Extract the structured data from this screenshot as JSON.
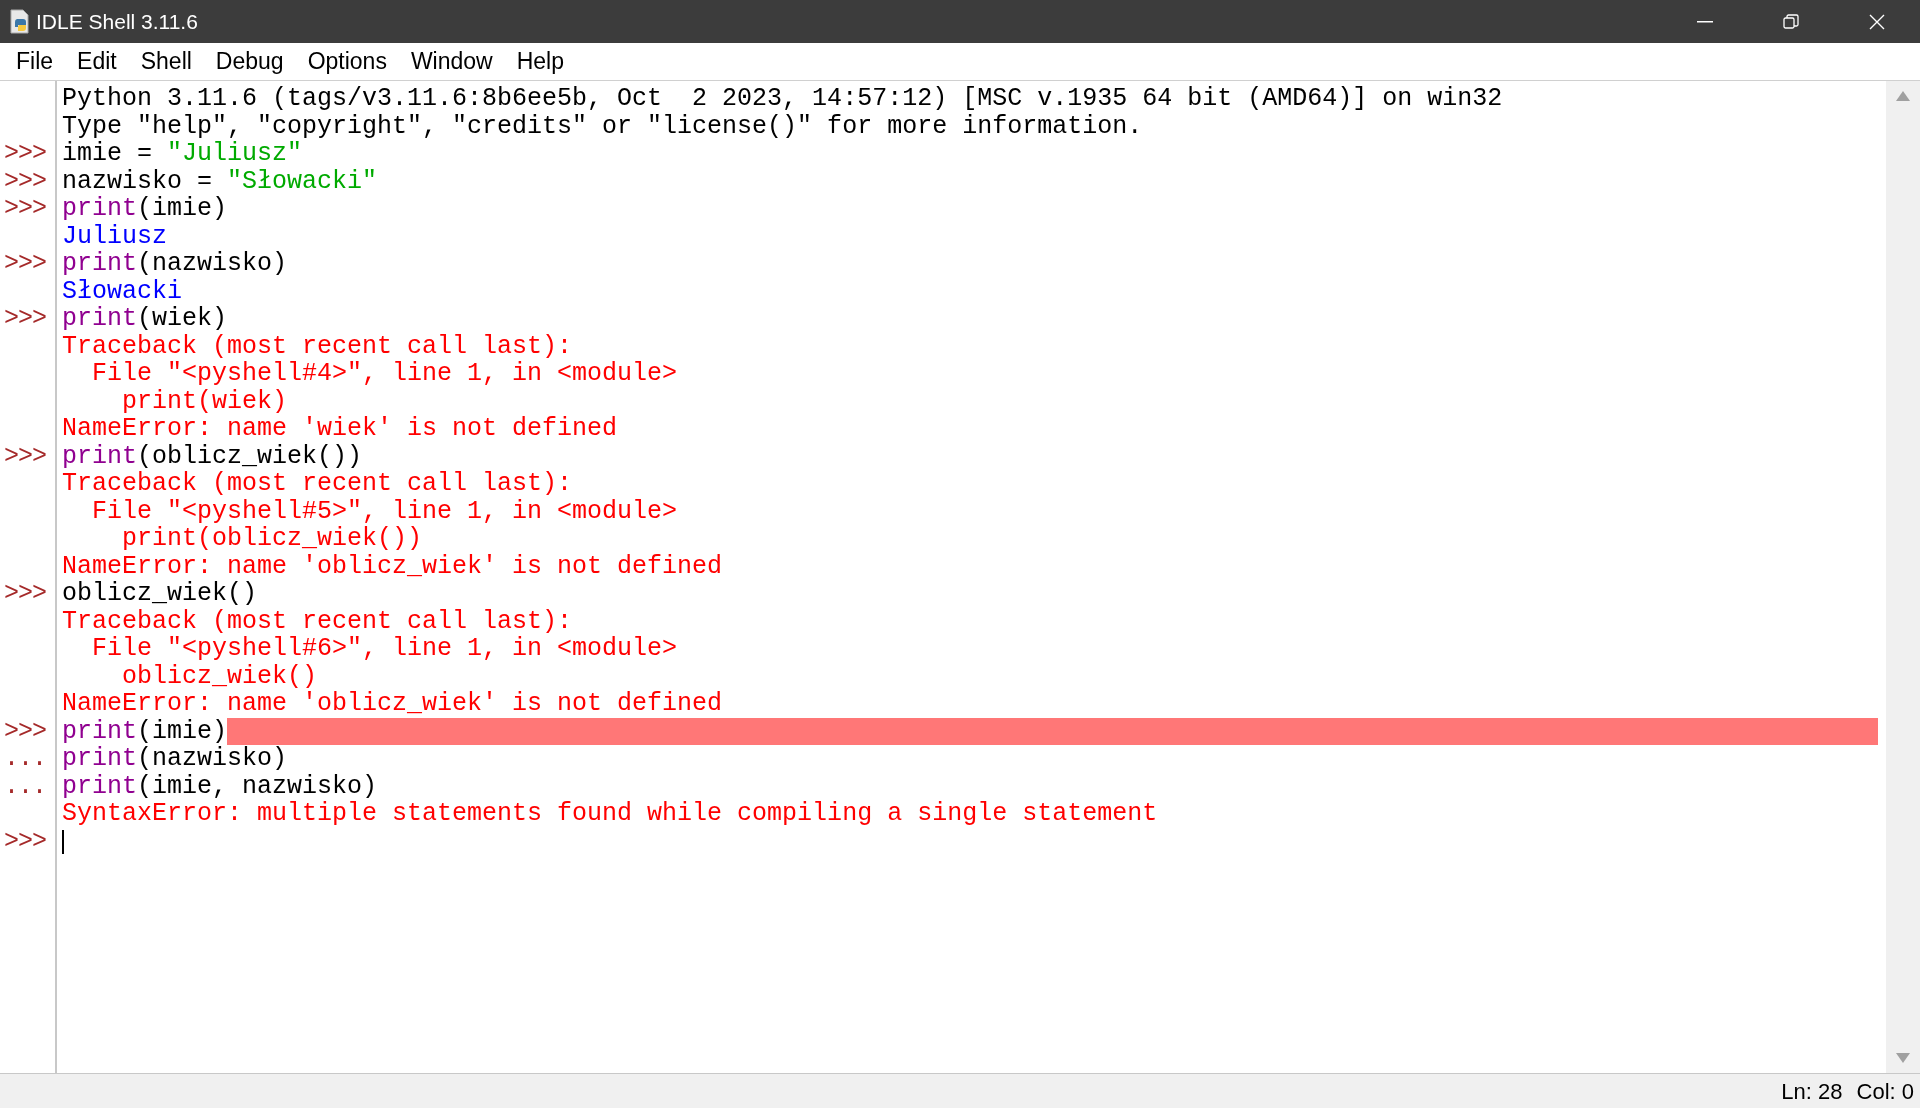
{
  "window": {
    "title": "IDLE Shell 3.11.6"
  },
  "menu": [
    "File",
    "Edit",
    "Shell",
    "Debug",
    "Options",
    "Window",
    "Help"
  ],
  "shell": {
    "lines": [
      {
        "marked": false,
        "cursor": false,
        "segments": [
          {
            "kind": "code",
            "text": "Python 3.11.6 (tags/v3.11.6:8b6ee5b, Oct  2 2023, 14:57:12) [MSC v.1935 64 bit (AMD64)] on win32"
          }
        ]
      },
      {
        "marked": false,
        "cursor": false,
        "segments": [
          {
            "kind": "code",
            "text": "Type \"help\", \"copyright\", \"credits\" or \"license()\" for more information."
          }
        ]
      },
      {
        "prompt": ">>>",
        "marked": false,
        "cursor": false,
        "segments": [
          {
            "kind": "code",
            "text": "imie = "
          },
          {
            "kind": "string",
            "text": "\"Juliusz\""
          }
        ]
      },
      {
        "prompt": ">>>",
        "marked": false,
        "cursor": false,
        "segments": [
          {
            "kind": "code",
            "text": "nazwisko = "
          },
          {
            "kind": "string",
            "text": "\"Słowacki\""
          }
        ]
      },
      {
        "prompt": ">>>",
        "marked": false,
        "cursor": false,
        "segments": [
          {
            "kind": "builtin",
            "text": "print"
          },
          {
            "kind": "code",
            "text": "(imie)"
          }
        ]
      },
      {
        "marked": false,
        "cursor": false,
        "segments": [
          {
            "kind": "output",
            "text": "Juliusz"
          }
        ]
      },
      {
        "prompt": ">>>",
        "marked": false,
        "cursor": false,
        "segments": [
          {
            "kind": "builtin",
            "text": "print"
          },
          {
            "kind": "code",
            "text": "(nazwisko)"
          }
        ]
      },
      {
        "marked": false,
        "cursor": false,
        "segments": [
          {
            "kind": "output",
            "text": "Słowacki"
          }
        ]
      },
      {
        "prompt": ">>>",
        "marked": false,
        "cursor": false,
        "segments": [
          {
            "kind": "builtin",
            "text": "print"
          },
          {
            "kind": "code",
            "text": "(wiek)"
          }
        ]
      },
      {
        "marked": false,
        "cursor": false,
        "segments": [
          {
            "kind": "error",
            "text": "Traceback (most recent call last):"
          }
        ]
      },
      {
        "marked": false,
        "cursor": false,
        "segments": [
          {
            "kind": "error",
            "text": "  File \"<pyshell#4>\", line 1, in <module>"
          }
        ]
      },
      {
        "marked": false,
        "cursor": false,
        "segments": [
          {
            "kind": "error",
            "text": "    print(wiek)"
          }
        ]
      },
      {
        "marked": false,
        "cursor": false,
        "segments": [
          {
            "kind": "error",
            "text": "NameError: name 'wiek' is not defined"
          }
        ]
      },
      {
        "prompt": ">>>",
        "marked": false,
        "cursor": false,
        "segments": [
          {
            "kind": "builtin",
            "text": "print"
          },
          {
            "kind": "code",
            "text": "(oblicz_wiek())"
          }
        ]
      },
      {
        "marked": false,
        "cursor": false,
        "segments": [
          {
            "kind": "error",
            "text": "Traceback (most recent call last):"
          }
        ]
      },
      {
        "marked": false,
        "cursor": false,
        "segments": [
          {
            "kind": "error",
            "text": "  File \"<pyshell#5>\", line 1, in <module>"
          }
        ]
      },
      {
        "marked": false,
        "cursor": false,
        "segments": [
          {
            "kind": "error",
            "text": "    print(oblicz_wiek())"
          }
        ]
      },
      {
        "marked": false,
        "cursor": false,
        "segments": [
          {
            "kind": "error",
            "text": "NameError: name 'oblicz_wiek' is not defined"
          }
        ]
      },
      {
        "prompt": ">>>",
        "marked": false,
        "cursor": false,
        "segments": [
          {
            "kind": "code",
            "text": "oblicz_wiek()"
          }
        ]
      },
      {
        "marked": false,
        "cursor": false,
        "segments": [
          {
            "kind": "error",
            "text": "Traceback (most recent call last):"
          }
        ]
      },
      {
        "marked": false,
        "cursor": false,
        "segments": [
          {
            "kind": "error",
            "text": "  File \"<pyshell#6>\", line 1, in <module>"
          }
        ]
      },
      {
        "marked": false,
        "cursor": false,
        "segments": [
          {
            "kind": "error",
            "text": "    oblicz_wiek()"
          }
        ]
      },
      {
        "marked": false,
        "cursor": false,
        "segments": [
          {
            "kind": "error",
            "text": "NameError: name 'oblicz_wiek' is not defined"
          }
        ]
      },
      {
        "prompt": ">>>",
        "marked": true,
        "cursor": false,
        "segments": [
          {
            "kind": "builtin",
            "text": "print"
          },
          {
            "kind": "code",
            "text": "(imie)"
          }
        ]
      },
      {
        "prompt": "...",
        "marked": false,
        "cursor": false,
        "segments": [
          {
            "kind": "builtin",
            "text": "print"
          },
          {
            "kind": "code",
            "text": "(nazwisko)"
          }
        ]
      },
      {
        "prompt": "...",
        "marked": false,
        "cursor": false,
        "segments": [
          {
            "kind": "builtin",
            "text": "print"
          },
          {
            "kind": "code",
            "text": "(imie, nazwisko)"
          }
        ]
      },
      {
        "marked": false,
        "cursor": false,
        "segments": [
          {
            "kind": "error",
            "text": "SyntaxError: multiple statements found while compiling a single statement"
          }
        ]
      },
      {
        "prompt": ">>>",
        "marked": false,
        "cursor": true
      }
    ]
  },
  "status_bar": {
    "line": "Ln: 28",
    "column": "Col: 0"
  }
}
